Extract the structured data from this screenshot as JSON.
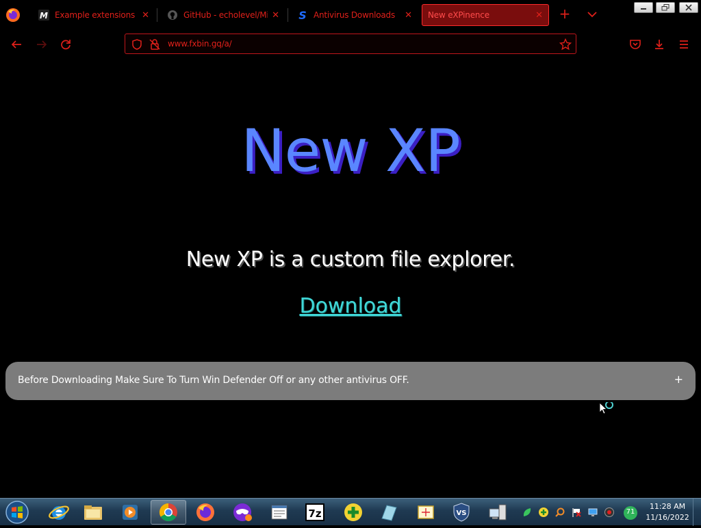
{
  "browser": {
    "tabs": [
      {
        "title": "Example extensions - M",
        "icon": "m-logo-icon",
        "active": false
      },
      {
        "title": "GitHub - echolevel/Mill",
        "icon": "github-icon",
        "active": false
      },
      {
        "title": "Antivirus Downloads",
        "icon": "s-logo-icon",
        "active": false
      },
      {
        "title": "New eXPinence",
        "icon": "none",
        "active": true
      }
    ],
    "url": "www.fxbin.gq/a/",
    "accent_color": "#e0201a"
  },
  "page": {
    "title": "New XP",
    "tagline": "New XP is a custom file explorer.",
    "download_label": "Download",
    "notice": "Before Downloading Make Sure To Turn Win Defender Off or any other antivirus OFF.",
    "notice_toggle": "+"
  },
  "taskbar": {
    "apps": [
      "internet-explorer",
      "file-explorer",
      "media-player",
      "chrome",
      "firefox",
      "mask-app",
      "notepad-app",
      "7zip",
      "add-app",
      "glass-app",
      "screenshot-app",
      "vs-shield",
      "remote-desktop"
    ],
    "tray_badge": "71",
    "clock_time": "11:28 AM",
    "clock_date": "11/16/2022"
  }
}
